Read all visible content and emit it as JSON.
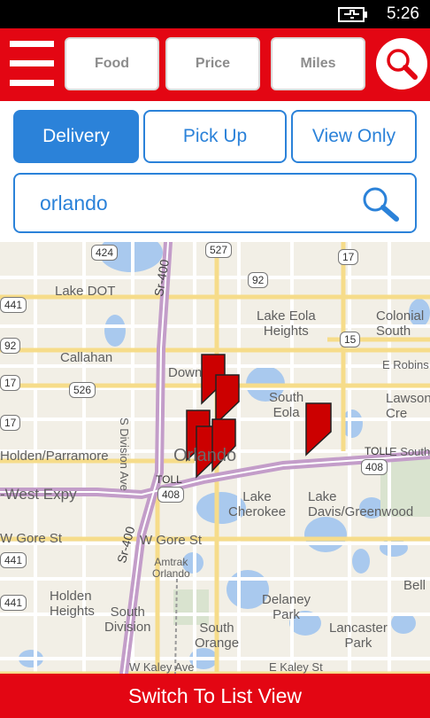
{
  "status": {
    "time": "5:26"
  },
  "header": {
    "menu_icon": "hamburger-icon",
    "filters": {
      "food": "Food",
      "price": "Price",
      "miles": "Miles"
    },
    "search_icon": "search-icon"
  },
  "modes": {
    "delivery": "Delivery",
    "pickup": "Pick Up",
    "view_only": "View Only",
    "active": "Delivery"
  },
  "search": {
    "value": "orlando"
  },
  "map": {
    "labels": {
      "lake_dot": "Lake DOT",
      "callahan": "Callahan",
      "holden_parramore": "Holden/Parramore",
      "west_expy": "-West Expy",
      "w_gore": "W Gore St",
      "w_gore2": "W Gore St",
      "holden_heights": "Holden\nHeights",
      "south_division": "South\nDivision",
      "amtrak": "Amtrak\nOrlando",
      "lake_eola_heights": "Lake Eola\nHeights",
      "colonial": "Colonial\nSouth",
      "e_robins": "E Robins",
      "lawson": "Lawson\nCre",
      "south_eola": "South\nEola",
      "orlando": "Orlando",
      "downtown": "Down",
      "toll1": "TOLL",
      "toll2": "TOLL",
      "e_south": "E South",
      "lake_cherokee": "Lake\nCherokee",
      "lake_davis": "Lake\nDavis/Greenwood",
      "delaney_park": "Delaney\nPark",
      "south_orange": "South\nOrange",
      "lancaster_park": "Lancaster\nPark",
      "bell": "Bell",
      "w_kaley": "W Kaley Ave",
      "e_kaley": "E Kaley St",
      "s_division_ave": "S Division Ave",
      "sr400_a": "Sr-400",
      "sr400_b": "Sr-400"
    },
    "shields": {
      "r424": "424",
      "r527": "527",
      "r17a": "17",
      "r92": "92",
      "r441a": "441",
      "r15": "15",
      "r92b": "92",
      "r17b": "17",
      "r526": "526",
      "r17c": "17",
      "r408a": "408",
      "r408b": "408",
      "r441b": "441",
      "r441c": "441"
    },
    "pins": 8
  },
  "bottom": {
    "switch_label": "Switch To List View"
  },
  "colors": {
    "brand_red": "#e30613",
    "accent_blue": "#2b82d9",
    "pin_red": "#cc0000"
  }
}
